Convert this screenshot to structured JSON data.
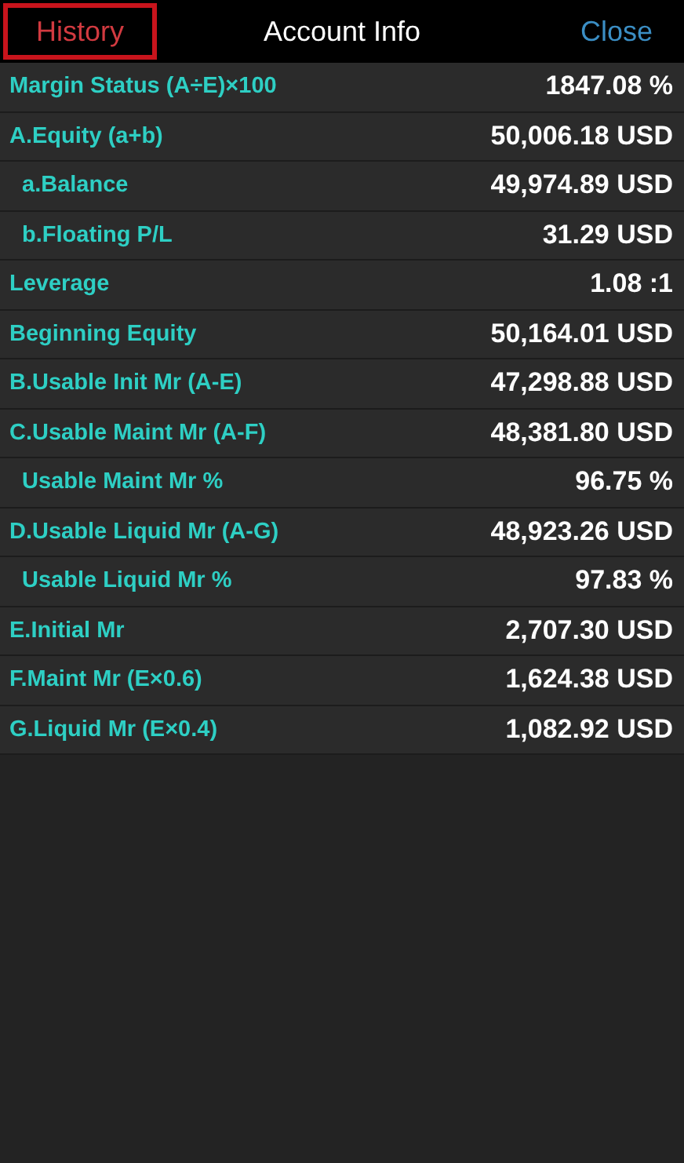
{
  "header": {
    "history": {
      "label": "History",
      "highlighted": true
    },
    "title": "Account Info",
    "close": "Close"
  },
  "rows": [
    {
      "label": "Margin Status (A÷E)×100",
      "value": "1847.08 %",
      "kind": "main"
    },
    {
      "label": "A.Equity (a+b)",
      "value": "50,006.18 USD",
      "kind": "main"
    },
    {
      "label": "a.Balance",
      "value": "49,974.89 USD",
      "kind": "sub"
    },
    {
      "label": "b.Floating P/L",
      "value": "31.29 USD",
      "kind": "sub"
    },
    {
      "label": "Leverage",
      "value": "1.08 :1",
      "kind": "main"
    },
    {
      "label": "Beginning Equity",
      "value": "50,164.01 USD",
      "kind": "main"
    },
    {
      "label": "B.Usable Init Mr (A-E)",
      "value": "47,298.88 USD",
      "kind": "main"
    },
    {
      "label": "C.Usable Maint Mr (A-F)",
      "value": "48,381.80 USD",
      "kind": "main"
    },
    {
      "label": "Usable Maint Mr %",
      "value": "96.75 %",
      "kind": "sub"
    },
    {
      "label": "D.Usable Liquid Mr (A-G)",
      "value": "48,923.26 USD",
      "kind": "main"
    },
    {
      "label": "Usable Liquid Mr %",
      "value": "97.83 %",
      "kind": "sub"
    },
    {
      "label": "E.Initial Mr",
      "value": "2,707.30 USD",
      "kind": "main"
    },
    {
      "label": "F.Maint Mr (E×0.6)",
      "value": "1,624.38 USD",
      "kind": "main"
    },
    {
      "label": "G.Liquid Mr (E×0.4)",
      "value": "1,082.92 USD",
      "kind": "main"
    }
  ]
}
